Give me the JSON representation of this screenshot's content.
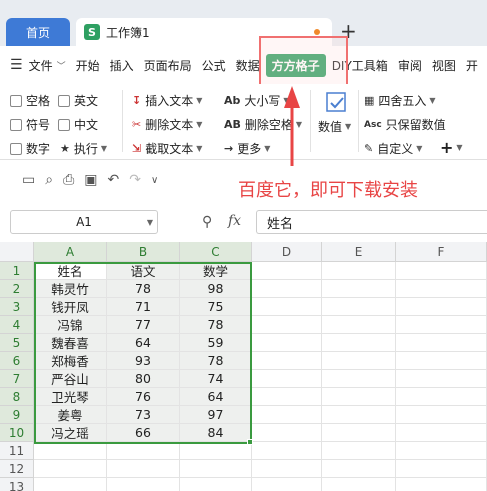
{
  "tabs": {
    "home": "首页",
    "doc": "工作簿1",
    "doc_icon": "S",
    "add": "+"
  },
  "menu": {
    "file": "文件",
    "items": [
      "开始",
      "插入",
      "页面布局",
      "公式",
      "数据",
      "方方格子",
      "DIY工具箱",
      "审阅",
      "视图",
      "开"
    ]
  },
  "ribbon": {
    "g1": [
      "空格",
      "英文",
      "符号",
      "中文",
      "数字",
      "执行"
    ],
    "g2": [
      "插入文本",
      "删除文本",
      "截取文本"
    ],
    "g3": [
      "大小写",
      "删除空格",
      "更多"
    ],
    "g3_icon_text": [
      "Ab",
      "AB"
    ],
    "g4": "数值",
    "g5": [
      "四舍五入",
      "只保留数值",
      "自定义"
    ],
    "g5_icon_text": "Asc"
  },
  "promo_text": "百度它，即可下载安装",
  "formula_bar": {
    "cell_ref": "A1",
    "fx": "fx",
    "content": "姓名"
  },
  "sheet": {
    "columns": [
      "A",
      "B",
      "C",
      "D",
      "E",
      "F"
    ],
    "row_numbers": [
      "1",
      "2",
      "3",
      "4",
      "5",
      "6",
      "7",
      "8",
      "9",
      "10",
      "11",
      "12",
      "13"
    ],
    "rows": [
      [
        "姓名",
        "语文",
        "数学"
      ],
      [
        "韩灵竹",
        "78",
        "98"
      ],
      [
        "钱开凤",
        "71",
        "75"
      ],
      [
        "冯锦",
        "77",
        "78"
      ],
      [
        "魏春喜",
        "64",
        "59"
      ],
      [
        "郑梅香",
        "93",
        "78"
      ],
      [
        "严谷山",
        "80",
        "74"
      ],
      [
        "卫光琴",
        "76",
        "64"
      ],
      [
        "姜粤",
        "73",
        "97"
      ],
      [
        "冯之瑶",
        "66",
        "84"
      ]
    ]
  },
  "colors": {
    "accent_green": "#2ea062",
    "home_tab_blue": "#3e7ad6",
    "highlight_red": "#e84545"
  }
}
